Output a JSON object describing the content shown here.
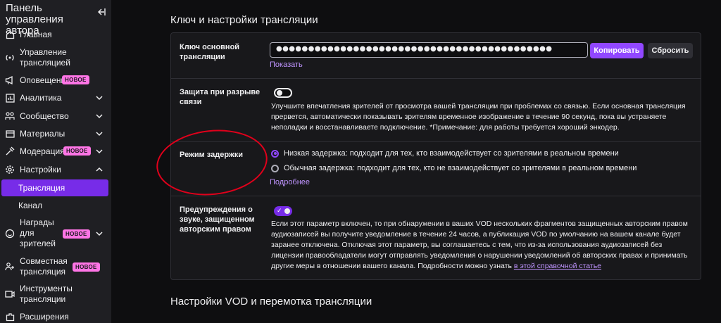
{
  "sidebar": {
    "title": "Панель управления автора",
    "items": [
      {
        "label": "Главная",
        "icon": "home-icon"
      },
      {
        "label": "Управление трансляцией",
        "icon": "broadcast-icon"
      },
      {
        "label": "Оповещения",
        "icon": "megaphone-icon",
        "badge": "НОВОЕ"
      },
      {
        "label": "Аналитика",
        "icon": "analytics-icon"
      },
      {
        "label": "Сообщество",
        "icon": "community-icon"
      },
      {
        "label": "Материалы",
        "icon": "content-icon"
      },
      {
        "label": "Модерация",
        "icon": "moderation-icon",
        "badge": "НОВОЕ"
      },
      {
        "label": "Настройки",
        "icon": "gear-icon"
      },
      {
        "label": "Трансляция"
      },
      {
        "label": "Канал"
      },
      {
        "label": "Награды для зрителей",
        "icon": "rewards-icon",
        "badge": "НОВОЕ"
      },
      {
        "label": "Совместная трансляция",
        "icon": "collab-icon",
        "badge": "НОВОЕ"
      },
      {
        "label": "Инструменты трансляции",
        "icon": "tools-icon"
      },
      {
        "label": "Расширения",
        "icon": "extensions-icon"
      }
    ]
  },
  "main": {
    "section1_title": "Ключ и настройки трансляции",
    "section2_title": "Настройки VOD и перемотка трансляции",
    "stream_key": {
      "label": "Ключ основной трансляции",
      "value": "●●●●●●●●●●●●●●●●●●●●●●●●●●●●●●●●●●●●●●●●●●●",
      "copy_label": "Копировать",
      "reset_label": "Сбросить",
      "show_label": "Показать"
    },
    "disconnect": {
      "label": "Защита при разрыве связи",
      "enabled": false,
      "description": "Улучшите впечатления зрителей от просмотра вашей трансляции при проблемах со связью. Если основная трансляция прервется, автоматически показывать зрителям временное изображение в течение 90 секунд, пока вы устраняете неполадки и восстанавливаете подключение. *Примечание: для работы требуется хороший энкодер."
    },
    "latency": {
      "label": "Режим задержки",
      "option_low": "Низкая задержка: подходит для тех, кто взаимодействует со зрителями в реальном времени",
      "option_normal": "Обычная задержка: подходит для тех, кто не взаимодействует со зрителями в реальном времени",
      "selected": "low",
      "more_label": "Подробнее"
    },
    "copyright": {
      "label": "Предупреждения о звуке, защищенном авторским правом",
      "enabled": true,
      "description": "Если этот параметр включен, то при обнаружении в ваших VOD нескольких фрагментов защищенных авторским правом аудиозаписей вы получите уведомление в течение 24 часов, а публикация VOD по умолчанию на вашем канале будет заранее отключена. Отключая этот параметр, вы соглашаетесь с тем, что из-за использования аудиозаписей без лицензии правообладатели могут отправлять уведомления о нарушении уведомлений об авторских правах и принимать другие меры в отношении вашего канала. Подробности можно узнать ",
      "link_label": "в этой справочной статье"
    }
  },
  "colors": {
    "accent": "#9147ff",
    "active_nav": "#772ce8",
    "badge": "#ff75e6",
    "annotation": "#e0001b"
  }
}
